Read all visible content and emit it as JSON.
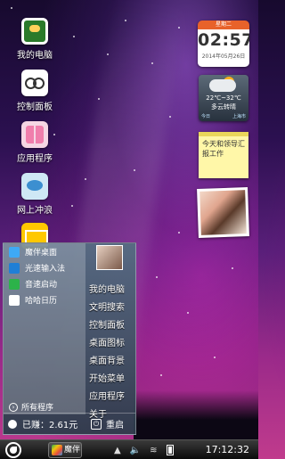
{
  "desktop": {
    "icons": [
      {
        "label": "我的电脑",
        "icon": "computer-icon"
      },
      {
        "label": "控制面板",
        "icon": "control-panel-icon"
      },
      {
        "label": "应用程序",
        "icon": "apps-icon"
      },
      {
        "label": "网上冲浪",
        "icon": "surf-icon"
      },
      {
        "label": "",
        "icon": "mail-icon"
      }
    ]
  },
  "widgets": {
    "clock": {
      "weekday": "星期二",
      "time": "02:57",
      "date": "2014年05月26日"
    },
    "weather": {
      "temp": "22℃~32℃",
      "condition": "多云转晴",
      "day": "今日",
      "city": "上海市"
    },
    "note": {
      "text": "今天和领导汇报工作"
    }
  },
  "start_menu": {
    "apps": [
      {
        "label": "魔伴桌面",
        "color": "#3ea9f5"
      },
      {
        "label": "光速输入法",
        "color": "#1f7fd6"
      },
      {
        "label": "音速启动",
        "color": "#2cb34a"
      },
      {
        "label": "哈哈日历",
        "color": "#ffffff"
      }
    ],
    "all_programs": "所有程序",
    "right_items": [
      "我的电脑",
      "文明搜索",
      "控制面板",
      "桌面图标",
      "桌面背景",
      "开始菜单",
      "应用程序",
      "关于"
    ],
    "earned": "已赚：2.61元",
    "restart": "重启"
  },
  "taskbar": {
    "task_label": "魔伴",
    "time": "17:12:32"
  }
}
